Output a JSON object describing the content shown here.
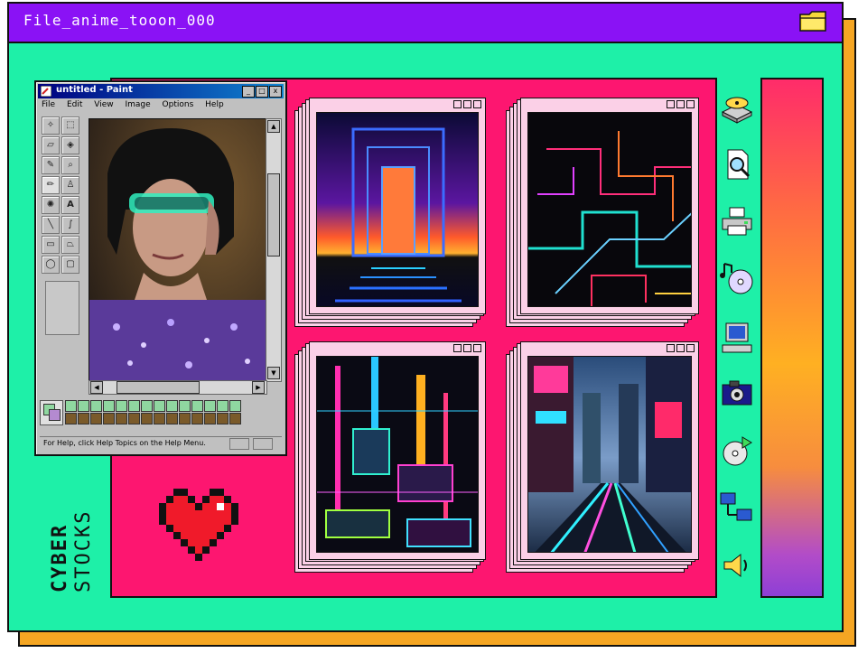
{
  "window": {
    "title": "File_anime_tooon_000",
    "folder_icon": "folder-icon"
  },
  "paint": {
    "title": "untitled - Paint",
    "menu": [
      "File",
      "Edit",
      "View",
      "Image",
      "Options",
      "Help"
    ],
    "status_text": "For Help, click Help Topics on the Help Menu.",
    "controls": [
      "_",
      "□",
      "x"
    ]
  },
  "gallery": {
    "windows": [
      "neon-portal",
      "neon-lines",
      "neon-tech-city",
      "neon-street"
    ]
  },
  "sidebar_icons": [
    "disk-drive-icon",
    "document-search-icon",
    "printer-icon",
    "music-cd-icon",
    "computer-icon",
    "camera-icon",
    "cd-player-icon",
    "network-icon",
    "speaker-icon"
  ],
  "branding": {
    "line1": "CYBER",
    "line2": "STOCKS"
  },
  "colors": {
    "titlebar": "#8a12f5",
    "background": "#1ef0a8",
    "panel": "#fd1670",
    "shadow": "#f5a623"
  }
}
